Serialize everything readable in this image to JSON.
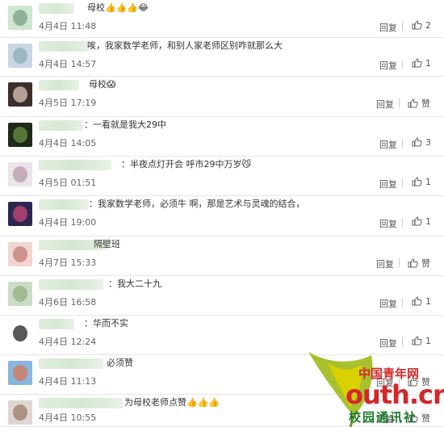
{
  "comments": [
    {
      "text": "母校👍👍👍😂",
      "date": "4月4日 11:48",
      "reply": "回复",
      "likes": "2"
    },
    {
      "text": "唉，我家数学老师，和别人家老师区别咋就那么大",
      "date": "4月4日 14:57",
      "reply": "回复",
      "likes": "1"
    },
    {
      "text": "母校😱",
      "date": "4月5日 17:19",
      "reply": "回复",
      "likes": "赞"
    },
    {
      "text": "：一看就是我大29中",
      "date": "4月4日 14:05",
      "reply": "回复",
      "likes": "3"
    },
    {
      "text": "：半夜点灯开会 呼市29中万岁😼",
      "date": "4月5日 01:51",
      "reply": "回复",
      "likes": "1"
    },
    {
      "text": "：我家数学老师，必须牛    啊，那是艺术与灵魂的结合，",
      "date": "4月4日 19:00",
      "reply": "回复",
      "likes": "1"
    },
    {
      "text": "隔壁班",
      "date": "4月7日 15:33",
      "reply": "回复",
      "likes": "赞"
    },
    {
      "text": "：我大二十九",
      "date": "4月6日 16:58",
      "reply": "回复",
      "likes": "1"
    },
    {
      "text": "：华而不实",
      "date": "4月4日 12:24",
      "reply": "回复",
      "likes": "1"
    },
    {
      "text": "必须赞",
      "date": "4月4日 11:13",
      "reply": "回复",
      "likes": "赞"
    },
    {
      "text": "为母校老师点赞👍👍👍",
      "date": "4月4日 10:55",
      "reply": "回复",
      "likes": "赞"
    }
  ],
  "watermark": {
    "cn_line": "中国青年网",
    "url": "outh.cn",
    "sub": "校园通讯社"
  },
  "colors": {
    "text": "#333333",
    "meta": "#666666",
    "divider": "#e6e6e6",
    "watermark_red": "#d4272b",
    "watermark_green": "#1d7a2c"
  }
}
